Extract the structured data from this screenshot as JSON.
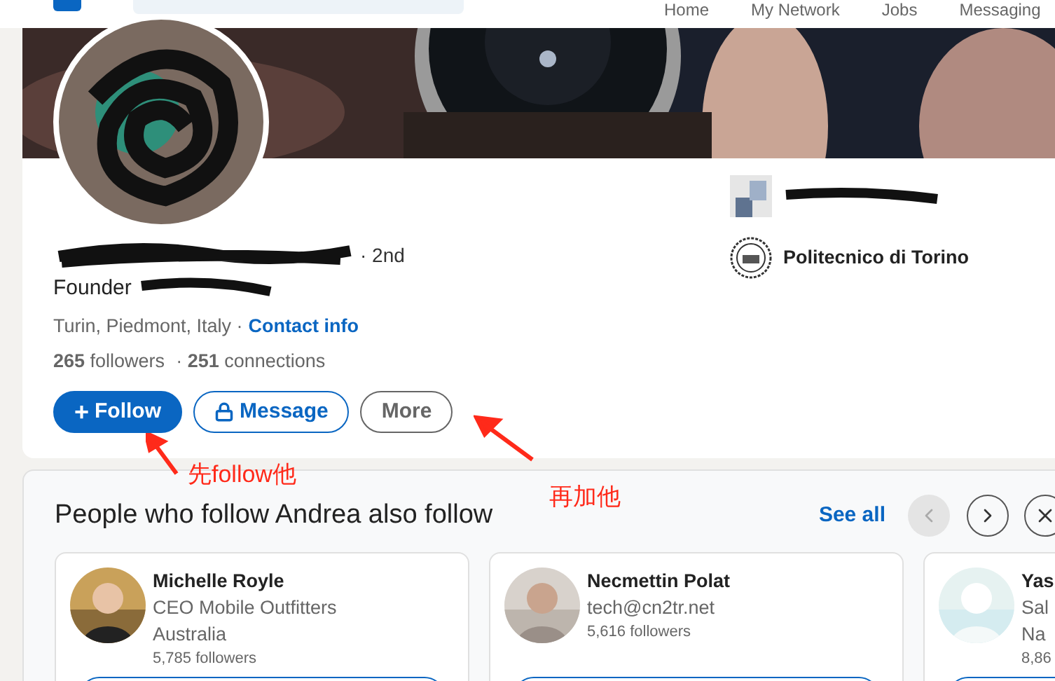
{
  "nav": {
    "items": [
      {
        "label": "Home"
      },
      {
        "label": "My Network"
      },
      {
        "label": "Jobs"
      },
      {
        "label": "Messaging"
      }
    ]
  },
  "profile": {
    "degree": "· 2nd",
    "headline": "Founder",
    "location": "Turin, Piedmont, Italy ·",
    "contact_link": "Contact info",
    "followers": "**265** followers",
    "connections": "· **251** connections",
    "actions": [
      {
        "kind": "primary",
        "icon": "+",
        "label": "Follow"
      },
      {
        "kind": "secondary",
        "label": "Message"
      },
      {
        "kind": "tertiary",
        "label": "More"
      }
    ],
    "education": "Politecnico di Torino"
  },
  "annotations": [
    {
      "text": "先follow他"
    },
    {
      "text": "再加他"
    }
  ],
  "suggestions": {
    "title": "People who follow Andrea also follow",
    "see_all": "See all",
    "people": [
      {
        "name": "Michelle Royle",
        "lines": [
          "CEO Mobile Outfitters",
          "Australia"
        ],
        "followers": "5,785 followers"
      },
      {
        "name": "Necmettin Polat",
        "lines": [
          "tech@cn2tr.net"
        ],
        "followers": "5,616 followers"
      },
      {
        "name": "Yas",
        "lines": [
          "Sal",
          "Na"
        ],
        "followers": "8,86"
      }
    ]
  }
}
